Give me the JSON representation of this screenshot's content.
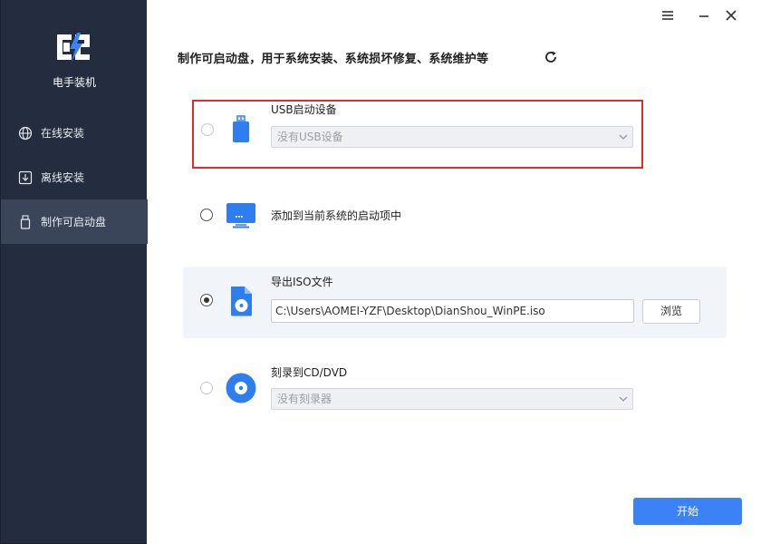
{
  "app": {
    "name": "电手装机"
  },
  "sidebar": {
    "items": [
      {
        "label": "在线安装",
        "icon": "globe-icon"
      },
      {
        "label": "离线安装",
        "icon": "download-icon"
      },
      {
        "label": "制作可启动盘",
        "icon": "usb-drive-icon",
        "active": true
      }
    ]
  },
  "titlebar": {
    "menu_icon": "menu-icon",
    "minimize_icon": "minimize-icon",
    "close_icon": "close-icon"
  },
  "main": {
    "title": "制作可启动盘，用于系统安装、系统损坏修复、系统维护等",
    "refresh_icon": "refresh-icon",
    "options": {
      "usb": {
        "label": "USB启动设备",
        "select_value": "没有USB设备",
        "icon": "usb-stick-icon",
        "checked": false,
        "disabled": true
      },
      "boot_entry": {
        "label": "添加到当前系统的启动项中",
        "icon": "monitor-icon",
        "checked": false
      },
      "iso": {
        "label": "导出ISO文件",
        "path": "C:\\Users\\AOMEI-YZF\\Desktop\\DianShou_WinPE.iso",
        "browse_label": "浏览",
        "icon": "iso-file-icon",
        "checked": true
      },
      "cd": {
        "label": "刻录到CD/DVD",
        "select_value": "没有刻录器",
        "icon": "disc-icon",
        "checked": false,
        "disabled": true
      }
    },
    "start_label": "开始"
  },
  "colors": {
    "sidebar_bg": "#232d3f",
    "sidebar_active": "#3a4559",
    "accent": "#3b82f6",
    "highlight": "#e02b2b"
  }
}
